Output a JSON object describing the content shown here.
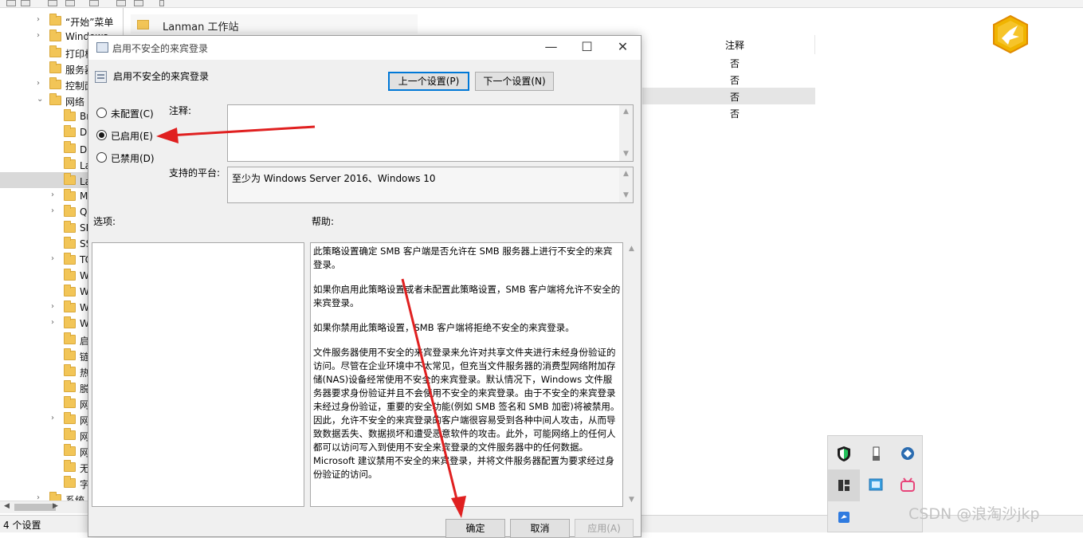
{
  "tree": {
    "rows": [
      {
        "label": "“开始”菜单",
        "expandable": true,
        "indent": 0
      },
      {
        "label": "Windows",
        "expandable": true,
        "indent": 0
      },
      {
        "label": "打印机",
        "expandable": false,
        "indent": 0
      },
      {
        "label": "服务器",
        "expandable": false,
        "indent": 0
      },
      {
        "label": "控制面板",
        "expandable": true,
        "indent": 0
      },
      {
        "label": "网络",
        "expandable": true,
        "expanded": true,
        "indent": 0
      },
      {
        "label": "BranchCache",
        "expandable": false,
        "indent": 1
      },
      {
        "label": "DirectAccess",
        "expandable": false,
        "indent": 1
      },
      {
        "label": "DNS 客户端",
        "expandable": false,
        "indent": 1
      },
      {
        "label": "Lanman 服务器",
        "expandable": false,
        "indent": 1
      },
      {
        "label": "Lanman 工作站",
        "expandable": false,
        "indent": 1,
        "selected": true
      },
      {
        "label": "Microsoft",
        "expandable": true,
        "indent": 1
      },
      {
        "label": "QoS",
        "expandable": true,
        "indent": 1
      },
      {
        "label": "SNMP",
        "expandable": false,
        "indent": 1
      },
      {
        "label": "SSL",
        "expandable": false,
        "indent": 1
      },
      {
        "label": "TCPIP",
        "expandable": true,
        "indent": 1
      },
      {
        "label": "WLAN",
        "expandable": false,
        "indent": 1
      },
      {
        "label": "WWAN",
        "expandable": false,
        "indent": 1
      },
      {
        "label": "Windows",
        "expandable": true,
        "indent": 1
      },
      {
        "label": "Windows",
        "expandable": true,
        "indent": 1
      },
      {
        "label": "启动",
        "expandable": false,
        "indent": 1
      },
      {
        "label": "链路",
        "expandable": false,
        "indent": 1
      },
      {
        "label": "热点",
        "expandable": false,
        "indent": 1
      },
      {
        "label": "脱机",
        "expandable": false,
        "indent": 1
      },
      {
        "label": "网络",
        "expandable": false,
        "indent": 1
      },
      {
        "label": "网络",
        "expandable": true,
        "indent": 1
      },
      {
        "label": "网络",
        "expandable": false,
        "indent": 1
      },
      {
        "label": "网络",
        "expandable": false,
        "indent": 1
      },
      {
        "label": "无线",
        "expandable": false,
        "indent": 1
      },
      {
        "label": "字体",
        "expandable": false,
        "indent": 1
      },
      {
        "label": "系统",
        "expandable": true,
        "indent": 0
      }
    ]
  },
  "status": {
    "text": "4 个设置"
  },
  "right_pane": {
    "folder_title": "Lanman 工作站",
    "col_comment": "注释",
    "rows": [
      "否",
      "否",
      "否",
      "否"
    ],
    "highlighted_row": 2
  },
  "dialog": {
    "window_title": "启用不安全的来宾登录",
    "window_buttons": {
      "minimize": "—",
      "maximize": "☐",
      "close": "✕"
    },
    "policy_name": "启用不安全的来宾登录",
    "prev_button": "上一个设置(P)",
    "next_button": "下一个设置(N)",
    "radios": [
      {
        "label": "未配置(C)",
        "checked": false
      },
      {
        "label": "已启用(E)",
        "checked": true
      },
      {
        "label": "已禁用(D)",
        "checked": false
      }
    ],
    "comment_label": "注释:",
    "comment_value": "",
    "platform_label": "支持的平台:",
    "platform_value": "至少为 Windows Server 2016、Windows 10",
    "options_label": "选项:",
    "help_label": "帮助:",
    "help_paragraphs": [
      "此策略设置确定 SMB 客户端是否允许在 SMB 服务器上进行不安全的来宾登录。",
      "如果你启用此策略设置或者未配置此策略设置，SMB 客户端将允许不安全的来宾登录。",
      "如果你禁用此策略设置，SMB 客户端将拒绝不安全的来宾登录。",
      "文件服务器使用不安全的来宾登录来允许对共享文件夹进行未经身份验证的访问。尽管在企业环境中不太常见，但充当文件服务器的消费型网络附加存储(NAS)设备经常使用不安全的来宾登录。默认情况下，Windows 文件服务器要求身份验证并且不会使用不安全的来宾登录。由于不安全的来宾登录未经过身份验证，重要的安全功能(例如 SMB 签名和 SMB 加密)将被禁用。因此，允许不安全的来宾登录的客户端很容易受到各种中间人攻击，从而导致数据丢失、数据损坏和遭受恶意软件的攻击。此外，可能网络上的任何人都可以访问写入到使用不安全来宾登录的文件服务器中的任何数据。Microsoft 建议禁用不安全的来宾登录，并将文件服务器配置为要求经过身份验证的访问。"
    ],
    "ok_button": "确定",
    "cancel_button": "取消",
    "apply_button": "应用(A)"
  },
  "tray": {
    "icons": [
      "security-shield-icon",
      "usb-drive-icon",
      "network-globe-icon",
      "app-window-icon",
      "remote-desktop-icon",
      "bilibili-icon",
      "feishu-icon"
    ]
  },
  "watermark": "CSDN @浪淘沙jkp",
  "colors": {
    "annotation_arrow": "#e02020",
    "selection_blue": "#0078d7",
    "folder_yellow": "#f2c557"
  }
}
